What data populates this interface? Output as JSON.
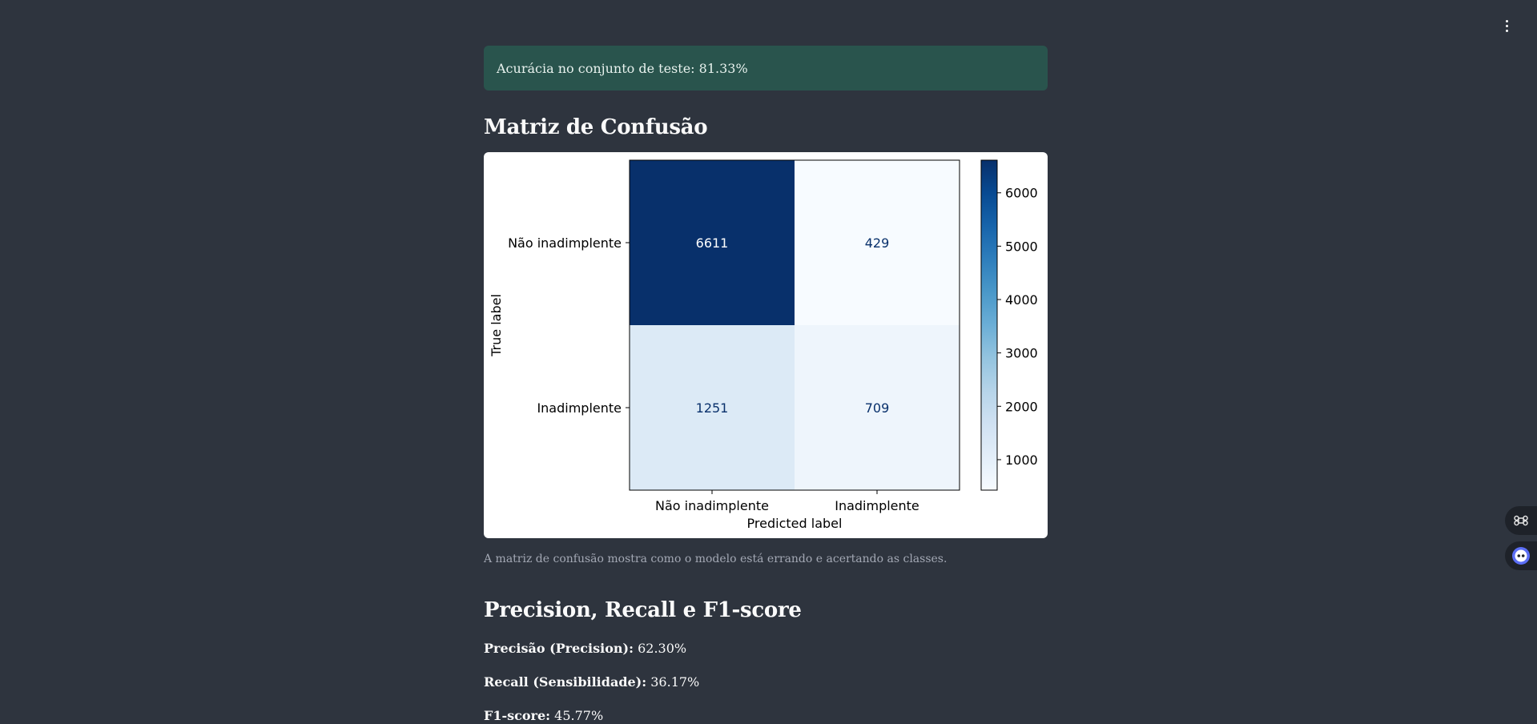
{
  "alert": {
    "text": "Acurácia no conjunto de teste: 81.33%"
  },
  "confusion_section": {
    "title": "Matriz de Confusão",
    "caption": "A matriz de confusão mostra como o modelo está errando e acertando as classes."
  },
  "metrics_section": {
    "title": "Precision, Recall e F1-score",
    "items": [
      {
        "label": "Precisão (Precision):",
        "value": "62.30%"
      },
      {
        "label": "Recall (Sensibilidade):",
        "value": "36.17%"
      },
      {
        "label": "F1-score:",
        "value": "45.77%"
      }
    ]
  },
  "icons": {
    "menu": "kebab-menu-icon",
    "side1": "command-key-icon",
    "side2": "assistant-bot-icon"
  },
  "colors": {
    "background": "#2e343e",
    "alert_bg": "#29544d",
    "cmap_dark": "#08306b",
    "cmap_light": "#f7fbff"
  },
  "chart_data": {
    "type": "heatmap",
    "title": "",
    "xlabel": "Predicted label",
    "ylabel": "True label",
    "x_categories": [
      "Não inadimplente",
      "Inadimplente"
    ],
    "y_categories": [
      "Não inadimplente",
      "Inadimplente"
    ],
    "values": [
      [
        6611,
        429
      ],
      [
        1251,
        709
      ]
    ],
    "colorbar": {
      "ticks": [
        1000,
        2000,
        3000,
        4000,
        5000,
        6000
      ],
      "range": [
        429,
        6611
      ],
      "colormap": "Blues"
    }
  }
}
